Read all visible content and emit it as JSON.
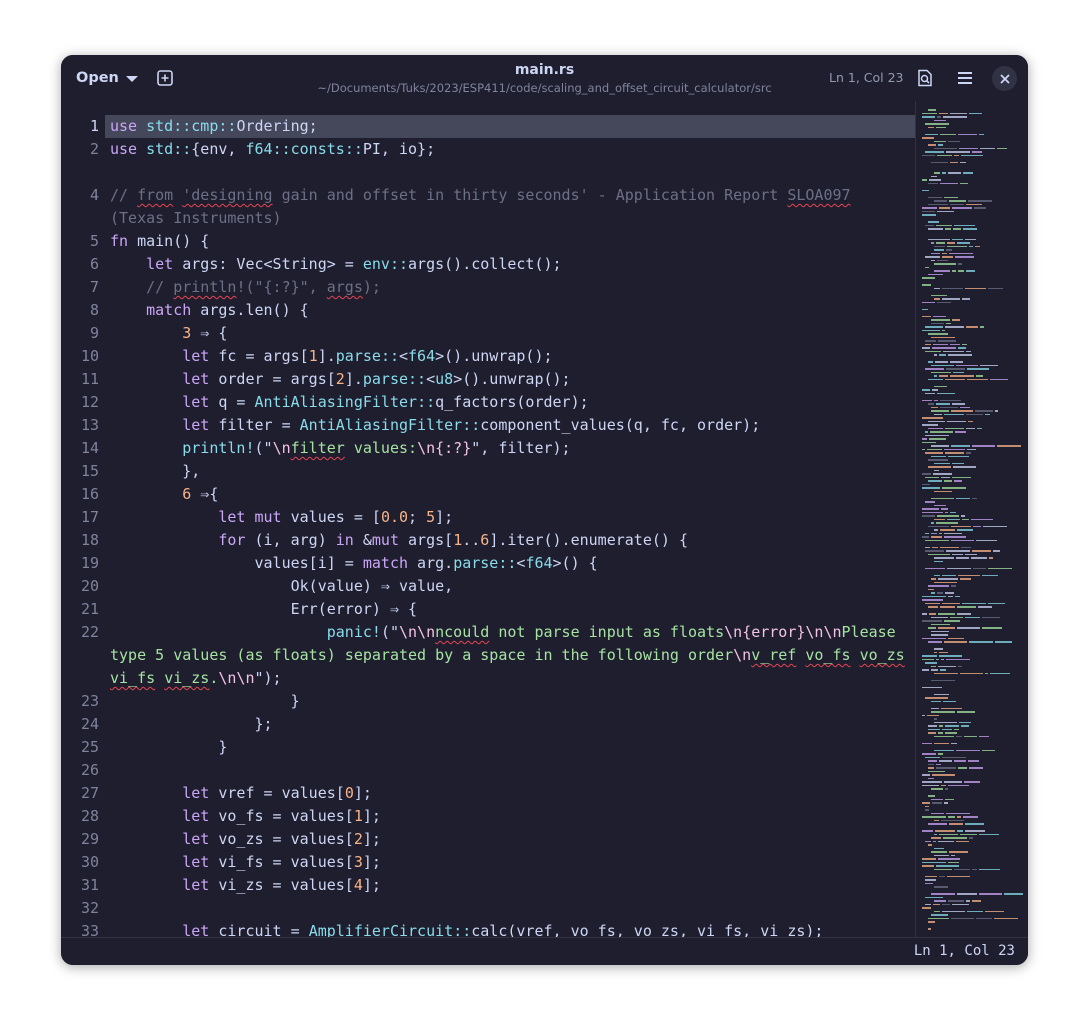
{
  "header": {
    "open_label": "Open",
    "title": "main.rs",
    "subtitle": "~/Documents/Tuks/2023/ESP411/code/scaling_and_offset_circuit_calculator/src",
    "cursor_position": "Ln 1, Col 23"
  },
  "icons": {
    "dropdown": "chevron-down-icon",
    "new_tab": "new-tab-icon",
    "search": "document-search-icon",
    "menu": "hamburger-menu-icon",
    "close": "close-icon"
  },
  "status_bar": {
    "cursor_position": "Ln 1, Col 23"
  },
  "colors": {
    "background": "#1e1e2e",
    "current_line": "#45475a",
    "keyword": "#cba6f7",
    "namespace": "#89dceb",
    "string": "#a6e3a1",
    "number": "#fab387",
    "comment": "#6c7086",
    "spell_error": "#e64553"
  },
  "editor": {
    "current_line": 1,
    "lines": [
      {
        "n": "1",
        "segments": [
          {
            "t": "use",
            "c": "kw"
          },
          {
            "t": " "
          },
          {
            "t": "std",
            "c": "ns"
          },
          {
            "t": "::",
            "c": "ns"
          },
          {
            "t": "cmp",
            "c": "ns"
          },
          {
            "t": "::",
            "c": "ns"
          },
          {
            "t": "Ordering;"
          }
        ]
      },
      {
        "n": "2",
        "segments": [
          {
            "t": "use",
            "c": "kw"
          },
          {
            "t": " "
          },
          {
            "t": "std",
            "c": "ns"
          },
          {
            "t": "::",
            "c": "ns"
          },
          {
            "t": "{env, "
          },
          {
            "t": "f64",
            "c": "ns"
          },
          {
            "t": "::",
            "c": "ns"
          },
          {
            "t": "consts",
            "c": "ns"
          },
          {
            "t": "::",
            "c": "ns"
          },
          {
            "t": "PI, io};"
          }
        ]
      },
      {
        "n": "",
        "segments": []
      },
      {
        "n": "4",
        "segments": [
          {
            "t": "// ",
            "c": "cm"
          },
          {
            "t": "from",
            "c": "cm sq"
          },
          {
            "t": " ",
            "c": "cm"
          },
          {
            "t": "'designing",
            "c": "cm sq"
          },
          {
            "t": " gain and offset in thirty seconds' - Application Report ",
            "c": "cm"
          },
          {
            "t": "SLOA097",
            "c": "cm sq"
          }
        ]
      },
      {
        "n": "",
        "segments": [
          {
            "t": "(Texas Instruments)",
            "c": "cm"
          }
        ]
      },
      {
        "n": "5",
        "segments": [
          {
            "t": "fn",
            "c": "kw"
          },
          {
            "t": " main() {"
          }
        ]
      },
      {
        "n": "6",
        "segments": [
          {
            "t": "    "
          },
          {
            "t": "let",
            "c": "kw"
          },
          {
            "t": " args: Vec<String> = "
          },
          {
            "t": "env",
            "c": "ns"
          },
          {
            "t": "::",
            "c": "ns"
          },
          {
            "t": "args().collect();"
          }
        ]
      },
      {
        "n": "7",
        "segments": [
          {
            "t": "    // ",
            "c": "cm"
          },
          {
            "t": "println",
            "c": "cm sq"
          },
          {
            "t": "!(\"{:?}\", ",
            "c": "cm"
          },
          {
            "t": "args",
            "c": "cm sq"
          },
          {
            "t": ");",
            "c": "cm"
          }
        ]
      },
      {
        "n": "8",
        "segments": [
          {
            "t": "    "
          },
          {
            "t": "match",
            "c": "kw"
          },
          {
            "t": " args.len() {"
          }
        ]
      },
      {
        "n": "9",
        "segments": [
          {
            "t": "        "
          },
          {
            "t": "3",
            "c": "num"
          },
          {
            "t": " ⇒ {"
          }
        ]
      },
      {
        "n": "10",
        "segments": [
          {
            "t": "        "
          },
          {
            "t": "let",
            "c": "kw"
          },
          {
            "t": " fc = args["
          },
          {
            "t": "1",
            "c": "num"
          },
          {
            "t": "]."
          },
          {
            "t": "parse",
            "c": "ns"
          },
          {
            "t": "::",
            "c": "ns"
          },
          {
            "t": "<"
          },
          {
            "t": "f64",
            "c": "ns"
          },
          {
            "t": ">().unwrap();"
          }
        ]
      },
      {
        "n": "11",
        "segments": [
          {
            "t": "        "
          },
          {
            "t": "let",
            "c": "kw"
          },
          {
            "t": " order = args["
          },
          {
            "t": "2",
            "c": "num"
          },
          {
            "t": "]."
          },
          {
            "t": "parse",
            "c": "ns"
          },
          {
            "t": "::",
            "c": "ns"
          },
          {
            "t": "<"
          },
          {
            "t": "u8",
            "c": "ns"
          },
          {
            "t": ">().unwrap();"
          }
        ]
      },
      {
        "n": "12",
        "segments": [
          {
            "t": "        "
          },
          {
            "t": "let",
            "c": "kw"
          },
          {
            "t": " q = "
          },
          {
            "t": "AntiAliasingFilter",
            "c": "ns"
          },
          {
            "t": "::",
            "c": "ns"
          },
          {
            "t": "q_factors(order);"
          }
        ]
      },
      {
        "n": "13",
        "segments": [
          {
            "t": "        "
          },
          {
            "t": "let",
            "c": "kw"
          },
          {
            "t": " filter = "
          },
          {
            "t": "AntiAliasingFilter",
            "c": "ns"
          },
          {
            "t": "::",
            "c": "ns"
          },
          {
            "t": "component_values(q, fc, order);"
          }
        ]
      },
      {
        "n": "14",
        "segments": [
          {
            "t": "        "
          },
          {
            "t": "println!",
            "c": "mac"
          },
          {
            "t": "(\""
          },
          {
            "t": "\\n",
            "c": "esc"
          },
          {
            "t": "filter",
            "c": "str sq"
          },
          {
            "t": " values:",
            "c": "str"
          },
          {
            "t": "\\n",
            "c": "esc"
          },
          {
            "t": "{:?}",
            "c": "esc"
          },
          {
            "t": "\", filter);"
          }
        ]
      },
      {
        "n": "15",
        "segments": [
          {
            "t": "        },"
          }
        ]
      },
      {
        "n": "16",
        "segments": [
          {
            "t": "        "
          },
          {
            "t": "6",
            "c": "num"
          },
          {
            "t": " ⇒{"
          }
        ]
      },
      {
        "n": "17",
        "segments": [
          {
            "t": "            "
          },
          {
            "t": "let",
            "c": "kw"
          },
          {
            "t": " "
          },
          {
            "t": "mut",
            "c": "kw"
          },
          {
            "t": " values = ["
          },
          {
            "t": "0.0",
            "c": "num"
          },
          {
            "t": "; "
          },
          {
            "t": "5",
            "c": "num"
          },
          {
            "t": "];"
          }
        ]
      },
      {
        "n": "18",
        "segments": [
          {
            "t": "            "
          },
          {
            "t": "for",
            "c": "kw"
          },
          {
            "t": " (i, arg) "
          },
          {
            "t": "in",
            "c": "kw"
          },
          {
            "t": " &"
          },
          {
            "t": "mut",
            "c": "kw"
          },
          {
            "t": " args["
          },
          {
            "t": "1",
            "c": "num"
          },
          {
            "t": ".."
          },
          {
            "t": "6",
            "c": "num"
          },
          {
            "t": "].iter().enumerate() {"
          }
        ]
      },
      {
        "n": "19",
        "segments": [
          {
            "t": "                values[i] = "
          },
          {
            "t": "match",
            "c": "kw"
          },
          {
            "t": " arg."
          },
          {
            "t": "parse",
            "c": "ns"
          },
          {
            "t": "::",
            "c": "ns"
          },
          {
            "t": "<"
          },
          {
            "t": "f64",
            "c": "ns"
          },
          {
            "t": ">() {"
          }
        ]
      },
      {
        "n": "20",
        "segments": [
          {
            "t": "                    Ok(value) ⇒ value,"
          }
        ]
      },
      {
        "n": "21",
        "segments": [
          {
            "t": "                    Err(error) ⇒ {"
          }
        ]
      },
      {
        "n": "22",
        "segments": [
          {
            "t": "                        "
          },
          {
            "t": "panic!",
            "c": "mac"
          },
          {
            "t": "(\""
          },
          {
            "t": "\\n\\n",
            "c": "esc"
          },
          {
            "t": "ncould",
            "c": "str sq"
          },
          {
            "t": " not parse input as floats",
            "c": "str"
          },
          {
            "t": "\\n",
            "c": "esc"
          },
          {
            "t": "{error}",
            "c": "esc"
          },
          {
            "t": "\\n\\n",
            "c": "esc"
          },
          {
            "t": "Please",
            "c": "str"
          }
        ]
      },
      {
        "n": "",
        "segments": [
          {
            "t": "type 5 values (as floats) separated by a space in the following order",
            "c": "str"
          },
          {
            "t": "\\n",
            "c": "esc"
          },
          {
            "t": "v_ref",
            "c": "str sq"
          },
          {
            "t": " ",
            "c": "str"
          },
          {
            "t": "vo_fs",
            "c": "str sq"
          },
          {
            "t": " ",
            "c": "str"
          },
          {
            "t": "vo_zs",
            "c": "str sq"
          }
        ]
      },
      {
        "n": "",
        "segments": [
          {
            "t": "vi_fs",
            "c": "str sq"
          },
          {
            "t": " ",
            "c": "str"
          },
          {
            "t": "vi_zs",
            "c": "str sq"
          },
          {
            "t": ".",
            "c": "str"
          },
          {
            "t": "\\n\\n",
            "c": "esc"
          },
          {
            "t": "\");"
          }
        ]
      },
      {
        "n": "23",
        "segments": [
          {
            "t": "                    }"
          }
        ]
      },
      {
        "n": "24",
        "segments": [
          {
            "t": "                };"
          }
        ]
      },
      {
        "n": "25",
        "segments": [
          {
            "t": "            }"
          }
        ]
      },
      {
        "n": "26",
        "segments": []
      },
      {
        "n": "27",
        "segments": [
          {
            "t": "        "
          },
          {
            "t": "let",
            "c": "kw"
          },
          {
            "t": " vref = values["
          },
          {
            "t": "0",
            "c": "num"
          },
          {
            "t": "];"
          }
        ]
      },
      {
        "n": "28",
        "segments": [
          {
            "t": "        "
          },
          {
            "t": "let",
            "c": "kw"
          },
          {
            "t": " vo_fs = values["
          },
          {
            "t": "1",
            "c": "num"
          },
          {
            "t": "];"
          }
        ]
      },
      {
        "n": "29",
        "segments": [
          {
            "t": "        "
          },
          {
            "t": "let",
            "c": "kw"
          },
          {
            "t": " vo_zs = values["
          },
          {
            "t": "2",
            "c": "num"
          },
          {
            "t": "];"
          }
        ]
      },
      {
        "n": "30",
        "segments": [
          {
            "t": "        "
          },
          {
            "t": "let",
            "c": "kw"
          },
          {
            "t": " vi_fs = values["
          },
          {
            "t": "3",
            "c": "num"
          },
          {
            "t": "];"
          }
        ]
      },
      {
        "n": "31",
        "segments": [
          {
            "t": "        "
          },
          {
            "t": "let",
            "c": "kw"
          },
          {
            "t": " vi_zs = values["
          },
          {
            "t": "4",
            "c": "num"
          },
          {
            "t": "];"
          }
        ]
      },
      {
        "n": "32",
        "segments": []
      },
      {
        "n": "33",
        "segments": [
          {
            "t": "        "
          },
          {
            "t": "let",
            "c": "kw"
          },
          {
            "t": " circuit = "
          },
          {
            "t": "AmplifierCircuit",
            "c": "ns"
          },
          {
            "t": "::",
            "c": "ns"
          },
          {
            "t": "calc(vref, vo_fs, vo_zs, vi_fs, vi_zs);"
          }
        ]
      }
    ]
  }
}
